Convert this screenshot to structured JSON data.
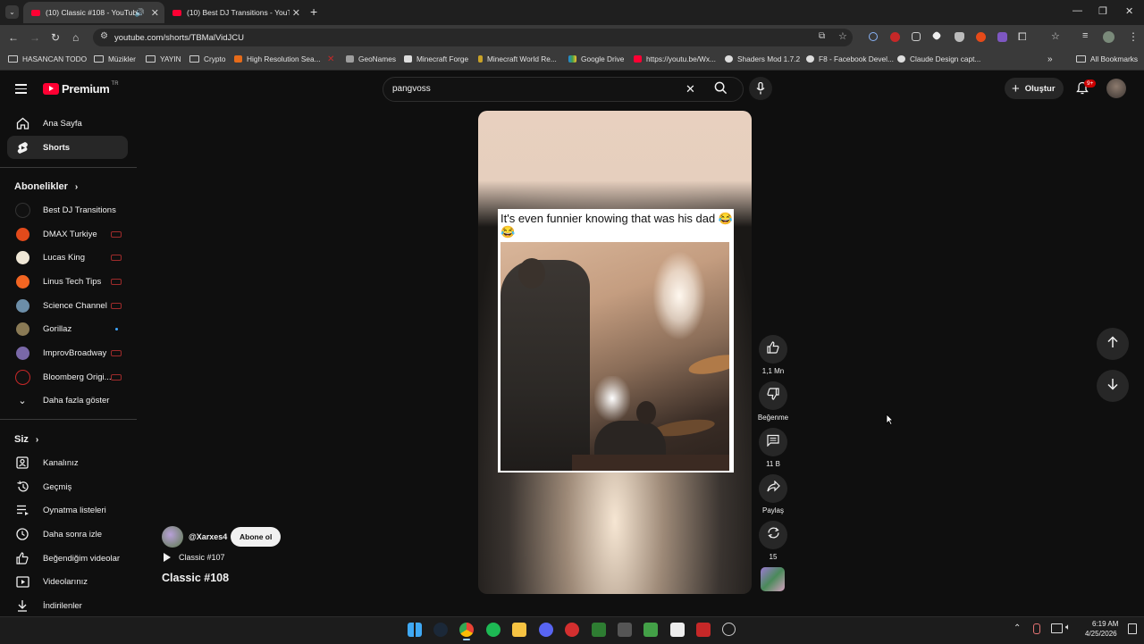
{
  "browser": {
    "tabs": [
      {
        "title": "(10) Classic #108 - YouTube"
      },
      {
        "title": "(10) Best DJ Transitions - YouTu"
      }
    ],
    "url": "youtube.com/shorts/TBMalVidJCU",
    "bookmarks": [
      "HASANCAN TODO",
      "Müzikler",
      "YAYIN",
      "Crypto",
      "High Resolution Sea...",
      "GeoNames",
      "Minecraft Forge",
      "Minecraft World Re...",
      "Google Drive",
      "https://youtu.be/Wx...",
      "Shaders Mod 1.7.2",
      "F8 - Facebook Devel...",
      "Claude Design capt..."
    ],
    "all_bookmarks": "All Bookmarks"
  },
  "yt": {
    "logo": "Premium",
    "region": "TR",
    "search_value": "pangvoss",
    "create_label": "Oluştur",
    "notif_badge": "9+"
  },
  "sidebar": {
    "home": "Ana Sayfa",
    "shorts": "Shorts",
    "subs_title": "Abonelikler",
    "subs": [
      "Best DJ Transitions",
      "DMAX Turkiye",
      "Lucas King",
      "Linus Tech Tips",
      "Science Channel",
      "Gorillaz",
      "ImprovBroadway",
      "Bloomberg Origi..."
    ],
    "show_more": "Daha fazla göster",
    "you_title": "Siz",
    "you_items": [
      "Kanalınız",
      "Geçmiş",
      "Oynatma listeleri",
      "Daha sonra izle",
      "Beğendiğim videolar",
      "Videolarınız",
      "İndirilenler"
    ]
  },
  "short": {
    "caption": "It's even funnier knowing that was his dad 😂😂",
    "channel": "@Xarxes4",
    "subscribe": "Abone ol",
    "playlist": "Classic #107",
    "title": "Classic #108",
    "likes": "1,1 Mn",
    "dislike": "Beğenme",
    "comments": "11 B",
    "share": "Paylaş",
    "remix": "15"
  },
  "taskbar": {
    "time": "6:19 AM",
    "date": "4/25/2026"
  }
}
